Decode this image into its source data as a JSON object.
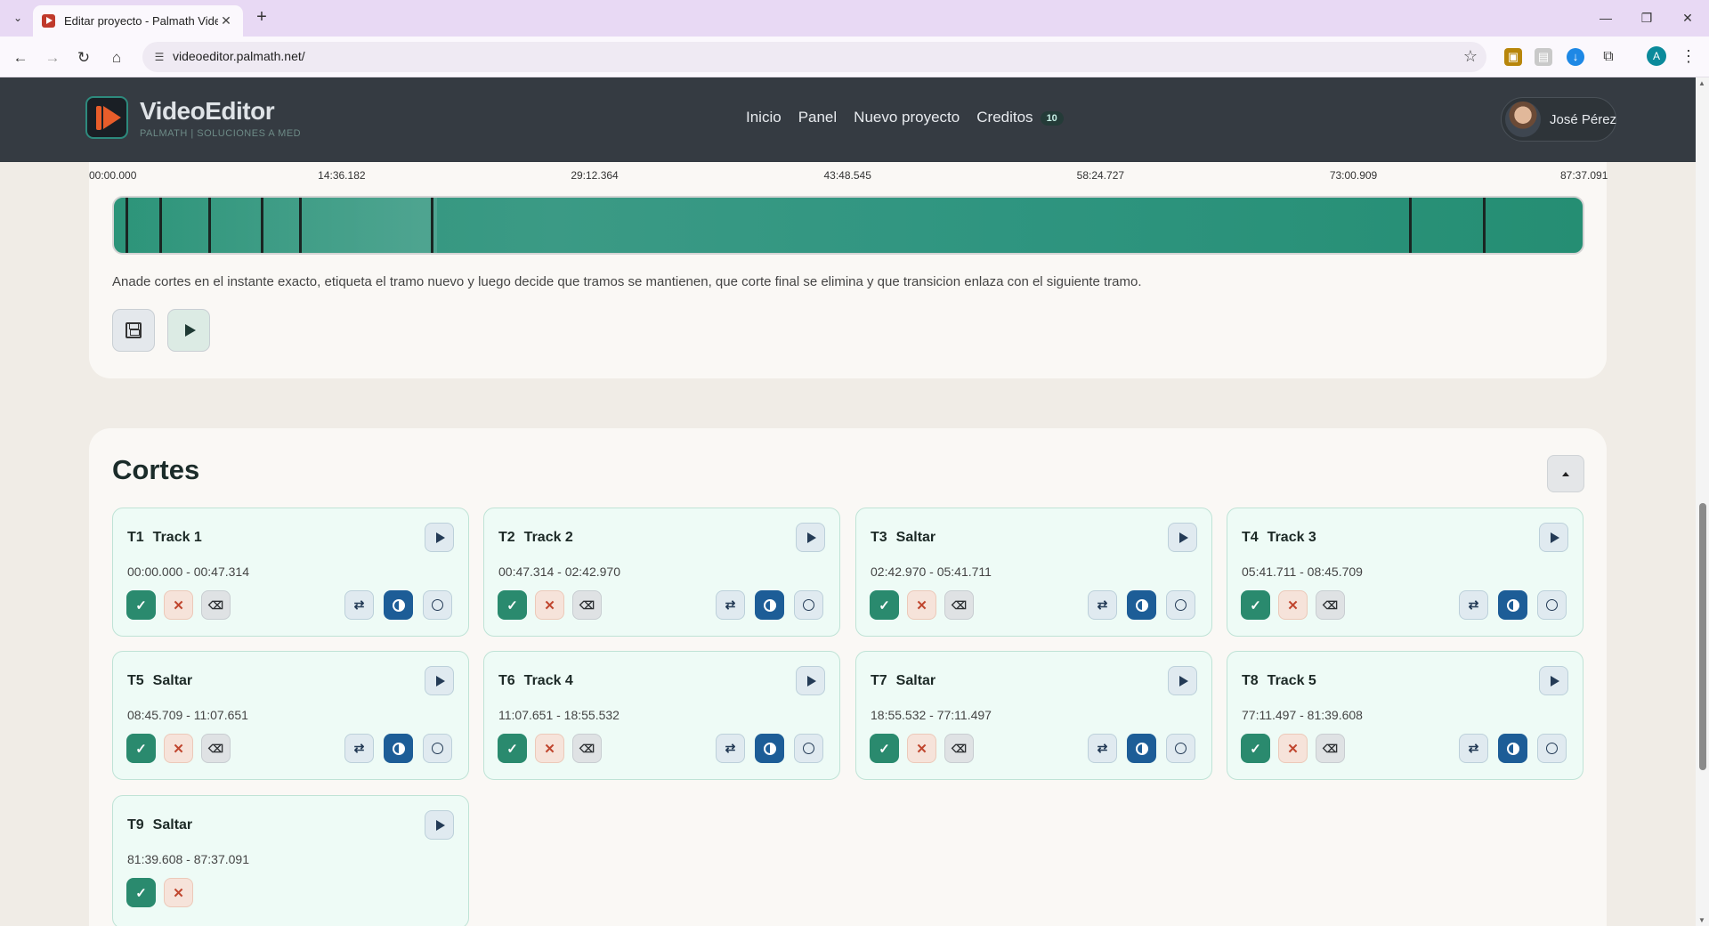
{
  "browser": {
    "tab_title": "Editar proyecto - Palmath Video",
    "url": "videoeditor.palmath.net/",
    "profile_initial": "A"
  },
  "header": {
    "brand_title": "VideoEditor",
    "brand_subtitle": "PALMATH | SOLUCIONES A MED",
    "nav": [
      "Inicio",
      "Panel",
      "Nuevo proyecto",
      "Creditos"
    ],
    "credits_count": "10",
    "user_name": "José Pérez"
  },
  "timeline": {
    "ticks": [
      "00:00.000",
      "14:36.182",
      "29:12.364",
      "43:48.545",
      "58:24.727",
      "73:00.909",
      "87:37.091"
    ],
    "cut_positions_fraction": [
      0.008,
      0.031,
      0.064,
      0.1,
      0.126,
      0.216,
      0.882,
      0.932
    ],
    "help_text": "Anade cortes en el instante exacto, etiqueta el tramo nuevo y luego decide que tramos se mantienen, que corte final se elimina y que transicion enlaza con el siguiente tramo."
  },
  "cuts": {
    "title": "Cortes",
    "segments": [
      {
        "id": "T1",
        "label": "Track 1",
        "range": "00:00.000 - 00:47.314"
      },
      {
        "id": "T2",
        "label": "Track 2",
        "range": "00:47.314 - 02:42.970"
      },
      {
        "id": "T3",
        "label": "Saltar",
        "range": "02:42.970 - 05:41.711"
      },
      {
        "id": "T4",
        "label": "Track 3",
        "range": "05:41.711 - 08:45.709"
      },
      {
        "id": "T5",
        "label": "Saltar",
        "range": "08:45.709 - 11:07.651"
      },
      {
        "id": "T6",
        "label": "Track 4",
        "range": "11:07.651 - 18:55.532"
      },
      {
        "id": "T7",
        "label": "Saltar",
        "range": "18:55.532 - 77:11.497"
      },
      {
        "id": "T8",
        "label": "Track 5",
        "range": "77:11.497 - 81:39.608"
      },
      {
        "id": "T9",
        "label": "Saltar",
        "range": "81:39.608 - 87:37.091"
      }
    ],
    "icons": {
      "keep": "✓",
      "drop": "✕",
      "delete": "⌫",
      "swap": "⇄"
    }
  },
  "colors": {
    "header_bg": "#353b42",
    "accent_green": "#2a8a6e",
    "accent_blue": "#1d5d97"
  }
}
